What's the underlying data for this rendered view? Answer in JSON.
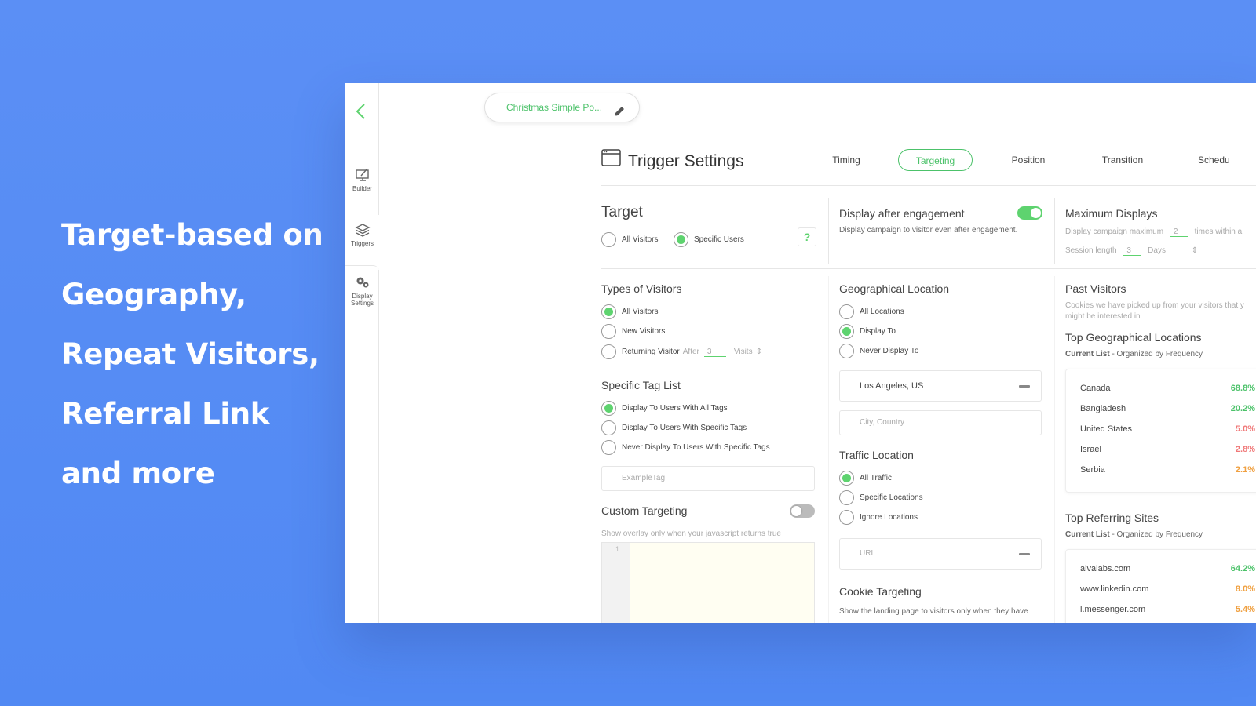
{
  "headline": [
    "Target-based on",
    "Geography,",
    "Repeat Visitors,",
    "Referral Link",
    "and more"
  ],
  "sidebar": {
    "items": [
      {
        "label": "Builder"
      },
      {
        "label": "Triggers"
      },
      {
        "label_line1": "Display",
        "label_line2": "Settings"
      }
    ]
  },
  "campaign": {
    "name": "Christmas Simple Po..."
  },
  "settings": {
    "title": "Trigger Settings",
    "tabs": [
      {
        "label": "Timing"
      },
      {
        "label": "Targeting"
      },
      {
        "label": "Position"
      },
      {
        "label": "Transition"
      },
      {
        "label": "Schedu"
      }
    ],
    "active_tab": "Targeting"
  },
  "target": {
    "title": "Target",
    "options": [
      {
        "label": "All Visitors",
        "selected": false
      },
      {
        "label": "Specific Users",
        "selected": true
      }
    ],
    "help": "?"
  },
  "engagement": {
    "title": "Display after engagement",
    "description": "Display campaign to visitor even after engagement.",
    "enabled": true
  },
  "max_displays": {
    "title": "Maximum Displays",
    "line1_prefix": "Display campaign maximum",
    "line1_value": "2",
    "line1_suffix": "times within a",
    "line2_prefix": "Session length",
    "line2_value": "3",
    "line2_unit": "Days"
  },
  "types_of_visitors": {
    "title": "Types of Visitors",
    "options": [
      {
        "label": "All Visitors",
        "selected": true
      },
      {
        "label": "New Visitors",
        "selected": false
      },
      {
        "label": "Returning Visitor",
        "selected": false
      }
    ],
    "after_label": "After",
    "after_value": "3",
    "visits_label": "Visits"
  },
  "tag_list": {
    "title": "Specific Tag List",
    "options": [
      {
        "label": "Display To Users With All Tags",
        "selected": true
      },
      {
        "label": "Display To Users With Specific Tags",
        "selected": false
      },
      {
        "label": "Never Display To Users With Specific Tags",
        "selected": false
      }
    ],
    "placeholder": "ExampleTag"
  },
  "custom_targeting": {
    "title": "Custom Targeting",
    "description": "Show overlay only when your javascript returns true",
    "enabled": false,
    "line_number": "1"
  },
  "geo": {
    "title": "Geographical Location",
    "options": [
      {
        "label": "All Locations",
        "selected": false
      },
      {
        "label": "Display To",
        "selected": true
      },
      {
        "label": "Never Display To",
        "selected": false
      }
    ],
    "location_value": "Los Angeles, US",
    "location_placeholder": "City, Country"
  },
  "traffic": {
    "title": "Traffic Location",
    "options": [
      {
        "label": "All Traffic",
        "selected": true
      },
      {
        "label": "Specific Locations",
        "selected": false
      },
      {
        "label": "Ignore Locations",
        "selected": false
      }
    ],
    "url_placeholder": "URL"
  },
  "cookie": {
    "title": "Cookie Targeting",
    "description": "Show the landing page to visitors only when they have"
  },
  "past_visitors": {
    "title": "Past Visitors",
    "description_line1": "Cookies we have picked up from your visitors that y",
    "description_line2": "might be interested in"
  },
  "top_geo": {
    "title": "Top Geographical Locations",
    "subtitle_strong": "Current List",
    "subtitle_rest": " - Organized by Frequency",
    "rows": [
      {
        "name": "Canada",
        "pct": "68.8%",
        "color": "#4cc26a"
      },
      {
        "name": "Bangladesh",
        "pct": "20.2%",
        "color": "#4cc26a"
      },
      {
        "name": "United States",
        "pct": "5.0%",
        "color": "#f07878"
      },
      {
        "name": "Israel",
        "pct": "2.8%",
        "color": "#f07878"
      },
      {
        "name": "Serbia",
        "pct": "2.1%",
        "color": "#f0a040"
      }
    ]
  },
  "top_ref": {
    "title": "Top Referring Sites",
    "subtitle_strong": "Current List",
    "subtitle_rest": " - Organized by Frequency",
    "rows": [
      {
        "name": "aivalabs.com",
        "pct": "64.2%",
        "color": "#4cc26a"
      },
      {
        "name": "www.linkedin.com",
        "pct": "8.0%",
        "color": "#f0a040"
      },
      {
        "name": "l.messenger.com",
        "pct": "5.4%",
        "color": "#f0a040"
      }
    ]
  },
  "colors": {
    "accent": "#5ed36f",
    "background": "#5b8ff5"
  }
}
